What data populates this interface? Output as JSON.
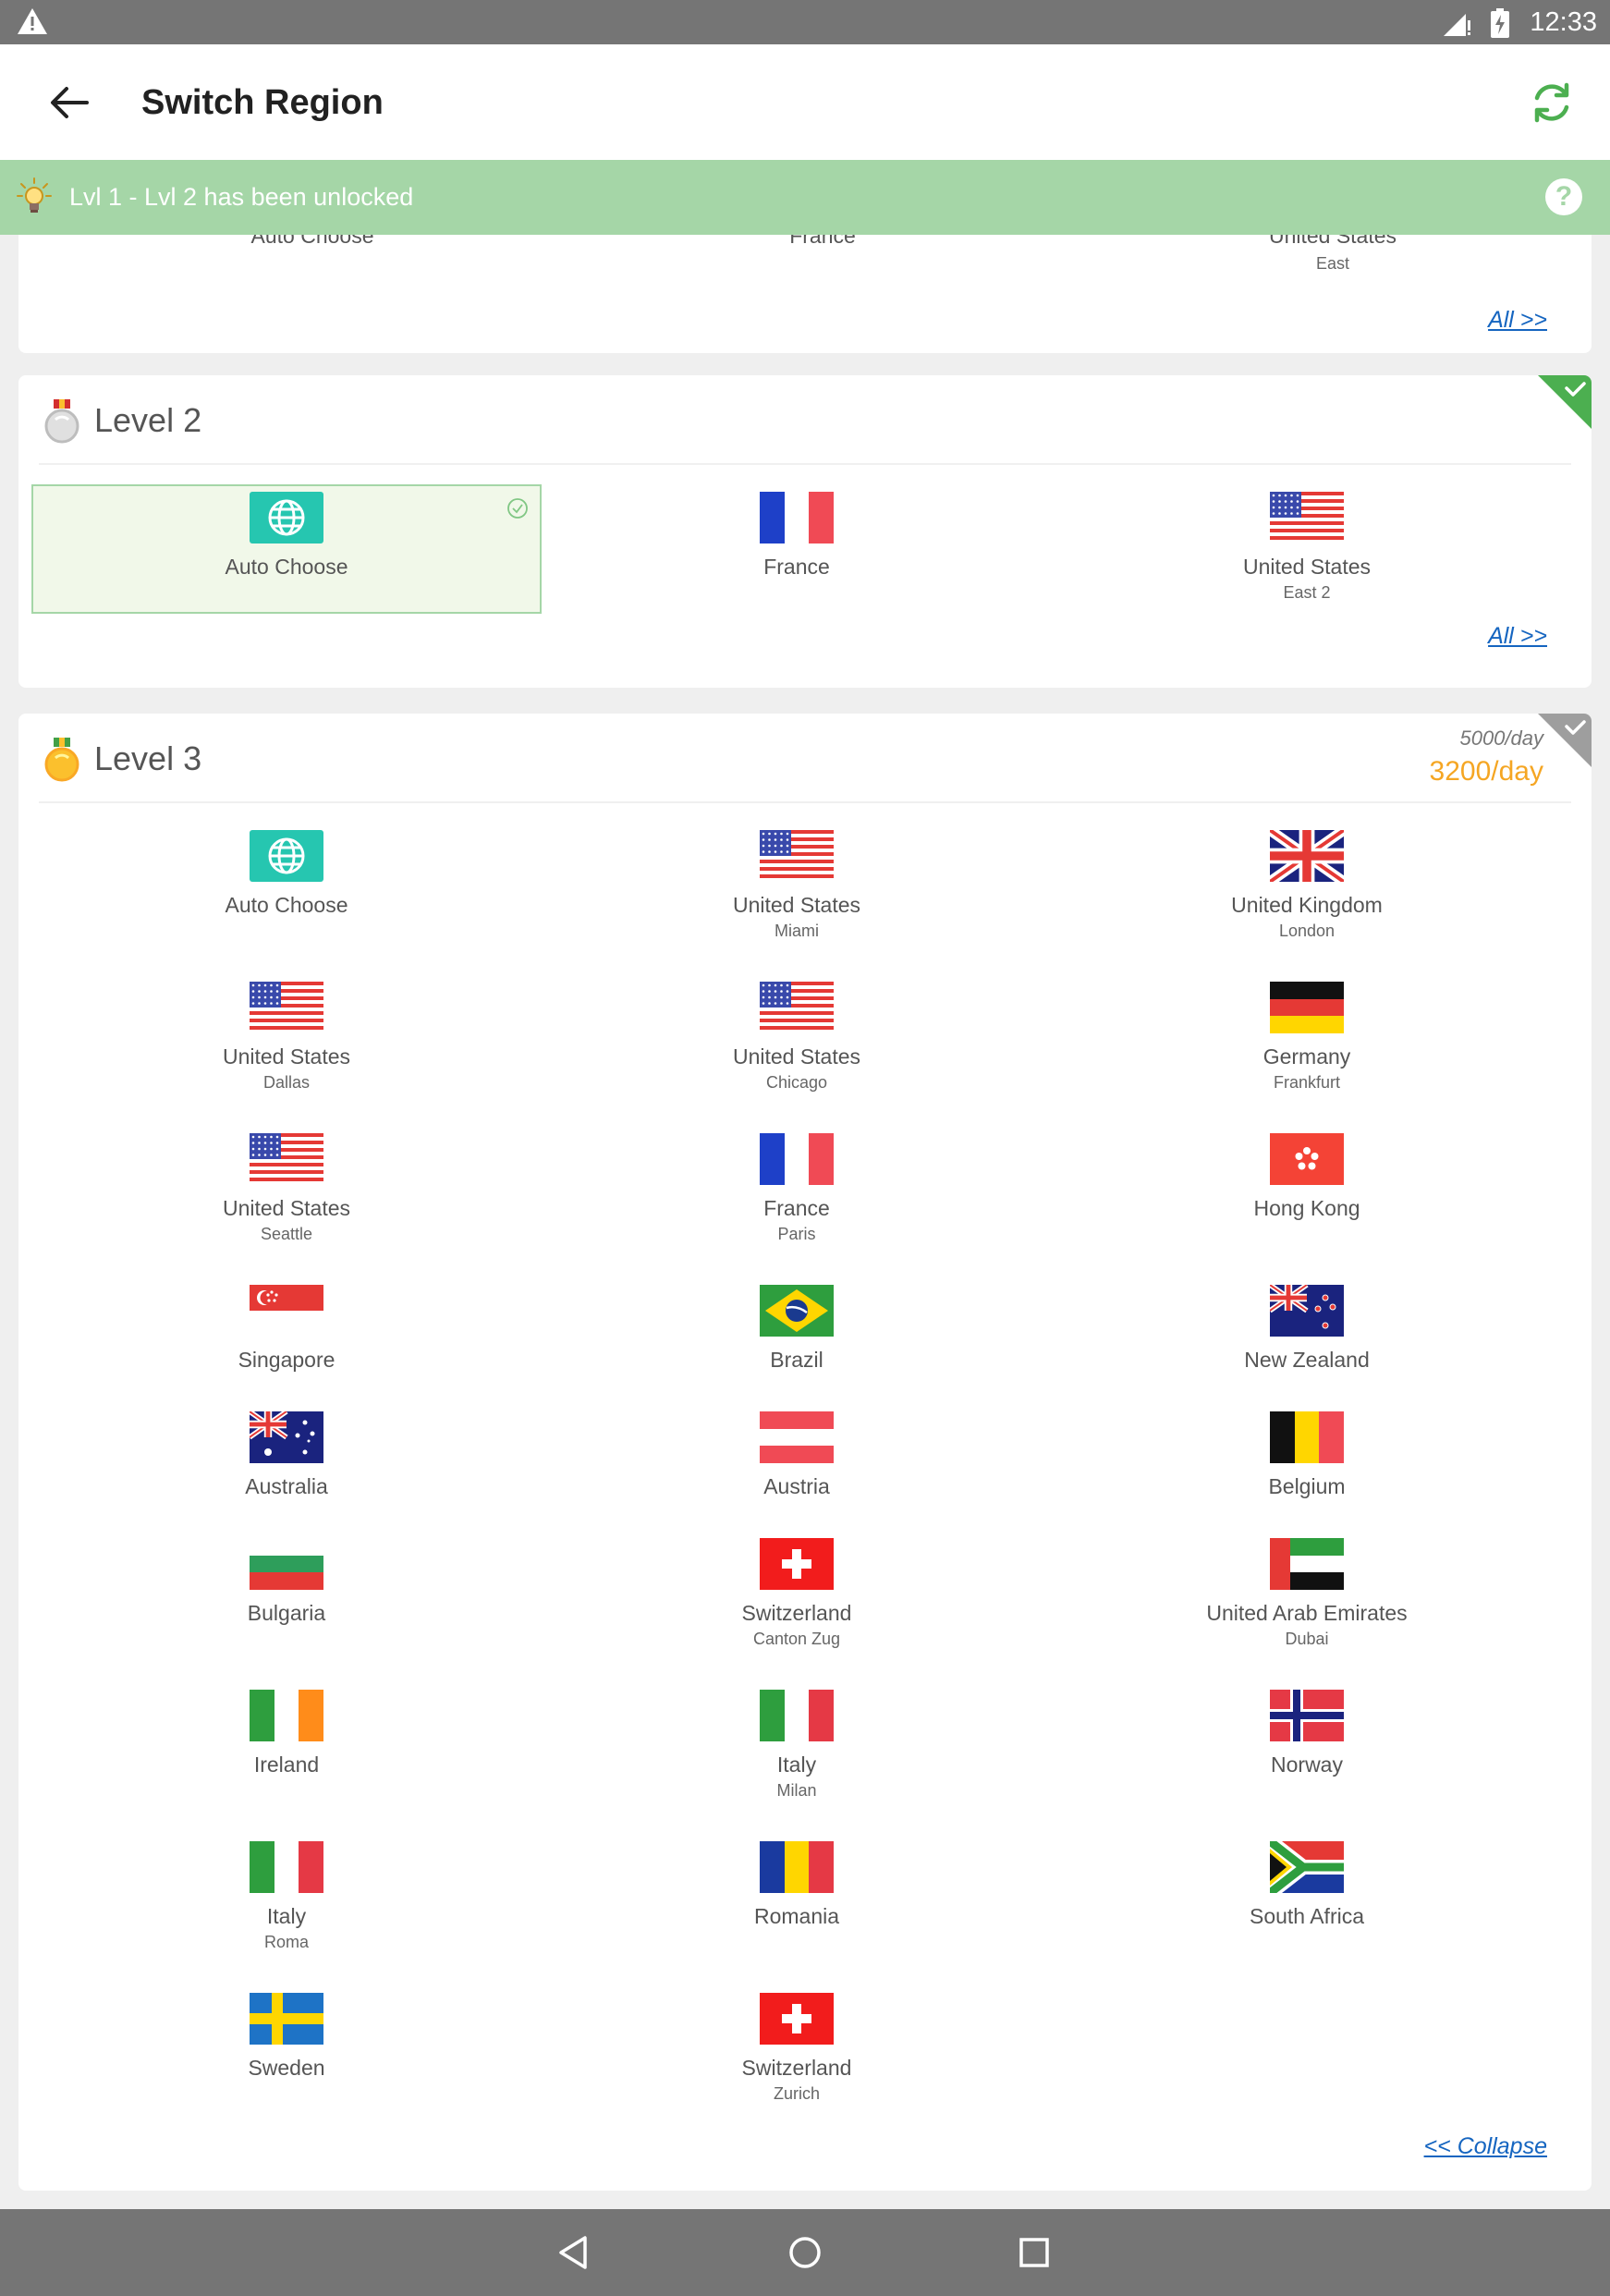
{
  "status_bar": {
    "time": "12:33"
  },
  "app_bar": {
    "title": "Switch Region"
  },
  "banner": {
    "text": "Lvl 1 - Lvl 2 has been unlocked",
    "help": "?"
  },
  "level1_partial": {
    "cells": [
      {
        "name": "Auto Choose",
        "sub": ""
      },
      {
        "name": "France",
        "sub": ""
      },
      {
        "name": "United States",
        "sub": "East"
      }
    ],
    "all_link": "All >>"
  },
  "level2": {
    "title": "Level 2",
    "regions": [
      {
        "name": "Auto Choose",
        "sub": "",
        "flag": "globe",
        "selected": true
      },
      {
        "name": "France",
        "sub": "",
        "flag": "fr"
      },
      {
        "name": "United States",
        "sub": "East 2",
        "flag": "us"
      }
    ],
    "all_link": "All >>"
  },
  "level3": {
    "title": "Level 3",
    "price_old": "5000/day",
    "price_new": "3200/day",
    "regions": [
      {
        "name": "Auto Choose",
        "sub": "",
        "flag": "globe"
      },
      {
        "name": "United States",
        "sub": "Miami",
        "flag": "us"
      },
      {
        "name": "United Kingdom",
        "sub": "London",
        "flag": "gb"
      },
      {
        "name": "United States",
        "sub": "Dallas",
        "flag": "us"
      },
      {
        "name": "United States",
        "sub": "Chicago",
        "flag": "us"
      },
      {
        "name": "Germany",
        "sub": "Frankfurt",
        "flag": "de"
      },
      {
        "name": "United States",
        "sub": "Seattle",
        "flag": "us"
      },
      {
        "name": "France",
        "sub": "Paris",
        "flag": "fr"
      },
      {
        "name": "Hong Kong",
        "sub": "",
        "flag": "hk"
      },
      {
        "name": "Singapore",
        "sub": "",
        "flag": "sg"
      },
      {
        "name": "Brazil",
        "sub": "",
        "flag": "br"
      },
      {
        "name": "New Zealand",
        "sub": "",
        "flag": "nz"
      },
      {
        "name": "Australia",
        "sub": "",
        "flag": "au"
      },
      {
        "name": "Austria",
        "sub": "",
        "flag": "at"
      },
      {
        "name": "Belgium",
        "sub": "",
        "flag": "be"
      },
      {
        "name": "Bulgaria",
        "sub": "",
        "flag": "bg"
      },
      {
        "name": "Switzerland",
        "sub": "Canton Zug",
        "flag": "ch"
      },
      {
        "name": "United Arab Emirates",
        "sub": "Dubai",
        "flag": "ae"
      },
      {
        "name": "Ireland",
        "sub": "",
        "flag": "ie"
      },
      {
        "name": "Italy",
        "sub": "Milan",
        "flag": "it"
      },
      {
        "name": "Norway",
        "sub": "",
        "flag": "no"
      },
      {
        "name": "Italy",
        "sub": "Roma",
        "flag": "it"
      },
      {
        "name": "Romania",
        "sub": "",
        "flag": "ro"
      },
      {
        "name": "South Africa",
        "sub": "",
        "flag": "za"
      },
      {
        "name": "Sweden",
        "sub": "",
        "flag": "se"
      },
      {
        "name": "Switzerland",
        "sub": "Zurich",
        "flag": "ch"
      }
    ],
    "collapse_link": "<< Collapse"
  },
  "colors": {
    "accent_green": "#4caf50",
    "banner_green": "#a5d6a7",
    "price_orange": "#f5a623",
    "link_blue": "#1565c0",
    "globe_teal": "#26c6b0"
  }
}
